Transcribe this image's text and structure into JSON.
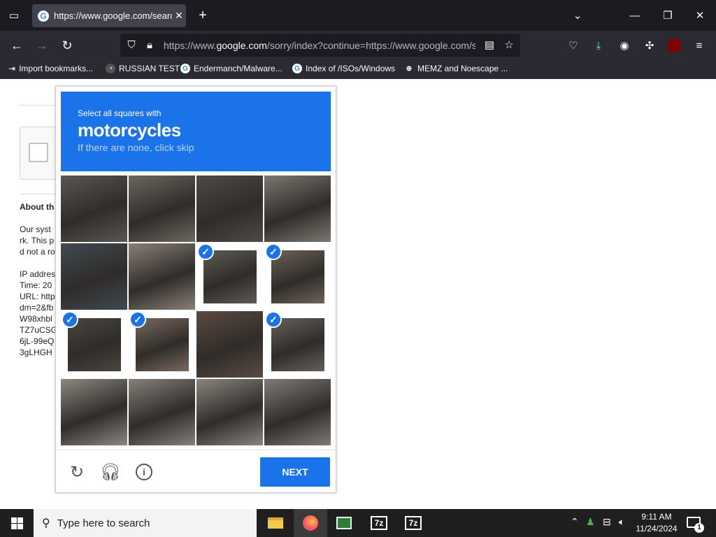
{
  "browser": {
    "tab_title": "https://www.google.com/searc",
    "url_prefix": "https://www.",
    "url_domain": "google.com",
    "url_rest": "/sorry/index?continue=https://www.google.com/s",
    "bookmarks": [
      "Import bookmarks...",
      "RUSSIAN TEST",
      "Endermanch/Malware...",
      "Index of /ISOs/Windows",
      "MEMZ and Noescape ..."
    ]
  },
  "page": {
    "about_heading": "About th",
    "body_lines": [
      "Our syst",
      "rk. This p",
      "d not a ro",
      "",
      "IP addres",
      "Time: 20",
      "URL: http",
      "dm=2&fb",
      "W98xhbl",
      "TZ7uCSG",
      "6jL-99eQ",
      "3gLHGH"
    ]
  },
  "captcha": {
    "instruction": "Select all squares with",
    "target": "motorcycles",
    "hint": "If there are none, click skip",
    "next_label": "NEXT",
    "selected_tiles": [
      6,
      7,
      8,
      9,
      11
    ],
    "tile_colors": [
      "#5a5752",
      "#6b6760",
      "#4e4a45",
      "#7d7770",
      "#3f4a52",
      "#8a7f78",
      "#5f5a55",
      "#6d6358",
      "#4a4640",
      "#7a6a5e",
      "#5c4a42",
      "#66605a",
      "#8d8780",
      "#86807a",
      "#8a847d",
      "#7f7a74"
    ]
  },
  "taskbar": {
    "search_placeholder": "Type here to search",
    "time": "9:11 AM",
    "date": "11/24/2024",
    "notifications": "1"
  }
}
